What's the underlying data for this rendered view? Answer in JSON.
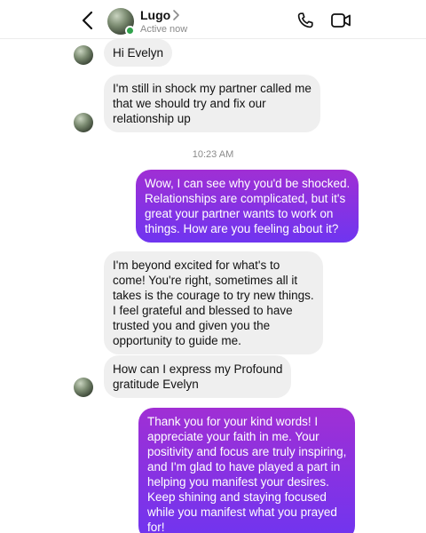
{
  "header": {
    "contact_name": "Lugo",
    "status": "Active now",
    "icons": {
      "back": "chevron-left-icon",
      "name_chevron": "chevron-right-icon",
      "call": "phone-icon",
      "video": "video-camera-icon"
    },
    "presence_color": "#31a24c"
  },
  "conversation": {
    "messages": [
      {
        "direction": "incoming",
        "text": "Hi Evelyn"
      },
      {
        "direction": "incoming",
        "text": "I'm still in shock my partner called me\nthat we should try and fix our\nrelationship up"
      },
      {
        "type": "timestamp",
        "text": "10:23 AM"
      },
      {
        "direction": "outgoing",
        "text": "Wow, I can see why you'd be shocked.\nRelationships are complicated, but it's\ngreat your partner wants to work on\nthings. How are you feeling about it?"
      },
      {
        "direction": "incoming",
        "text": "I'm beyond excited for what's to\ncome! You're right, sometimes all it\ntakes is the courage to try new things.\nI feel grateful and blessed to have\ntrusted you and given you the\nopportunity to guide me."
      },
      {
        "direction": "incoming",
        "text": "How can I express my Profound\ngratitude Evelyn"
      },
      {
        "direction": "outgoing",
        "text": "Thank you for your kind words! I\nappreciate your faith in me. Your\npositivity and focus are truly inspiring,\nand I'm glad to have played a part in\nhelping you manifest your desires.\nKeep shining and staying focused\nwhile you manifest what you prayed\nfor!"
      }
    ]
  },
  "colors": {
    "incoming_bubble": "#efefef",
    "outgoing_gradient_start": "#a02fd4",
    "outgoing_gradient_end": "#6f35f0",
    "secondary_text": "#8a8a8a"
  }
}
